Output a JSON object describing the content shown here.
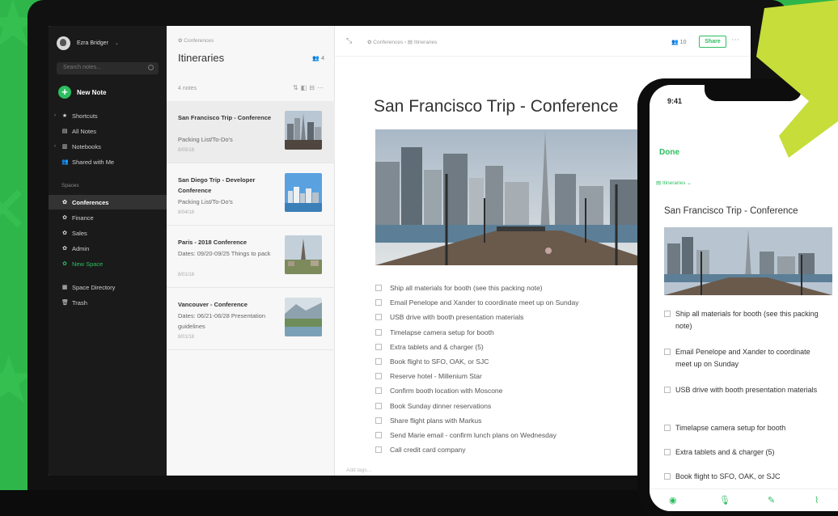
{
  "sidebar": {
    "account_name": "Ezra Bridger",
    "search_placeholder": "Search notes...",
    "new_note": "New Note",
    "items": [
      {
        "label": "Shortcuts",
        "icon": "star-icon"
      },
      {
        "label": "All Notes",
        "icon": "notes-icon"
      },
      {
        "label": "Notebooks",
        "icon": "notebook-icon"
      },
      {
        "label": "Shared with Me",
        "icon": "people-icon"
      }
    ],
    "spaces_label": "Spaces",
    "spaces": [
      {
        "label": "Conferences",
        "active": true
      },
      {
        "label": "Finance"
      },
      {
        "label": "Sales"
      },
      {
        "label": "Admin"
      },
      {
        "label": "New Space",
        "green": true
      }
    ],
    "bottom": [
      {
        "label": "Space Directory",
        "icon": "directory-icon"
      },
      {
        "label": "Trash",
        "icon": "trash-icon"
      }
    ]
  },
  "notelist": {
    "space": "Conferences",
    "title": "Itineraries",
    "people_count": "4",
    "count": "4 notes",
    "notes": [
      {
        "title": "San Francisco Trip - Conference",
        "snippet": "Packing List/To-Do's",
        "date": "8/05/18"
      },
      {
        "title": "San Diego Trip - Developer Conference",
        "snippet": "Packing List/To-Do's",
        "date": "8/04/18"
      },
      {
        "title": "Paris - 2018 Conference",
        "snippet": "Dates: 09/20-09/25 Things to pack",
        "date": "8/01/18"
      },
      {
        "title": "Vancouver - Conference",
        "snippet": "Dates: 06/21-06/28 Presentation guidelines",
        "date": "8/01/18"
      }
    ]
  },
  "editor": {
    "breadcrumb_space": "Conferences",
    "breadcrumb_notebook": "Itineraries",
    "people_count": "10",
    "share": "Share",
    "title": "San Francisco Trip - Conference",
    "checklist": [
      "Ship all materials for booth (see this packing note)",
      "Email Penelope and Xander to coordinate meet up on Sunday",
      "USB drive with booth presentation materials",
      "Timelapse camera setup for booth",
      "Extra tablets and & charger (5)",
      "Book flight to SFO, OAK, or SJC",
      "Reserve hotel - Millenium Star",
      "Confirm booth location with Moscone",
      "Book Sunday dinner reservations",
      "Share flight plans with Markus",
      "Send Marie email - confirm lunch plans on Wednesday",
      "Call credit card company"
    ],
    "add_tags": "Add tags..."
  },
  "phone": {
    "time": "9:41",
    "done": "Done",
    "notebook": "Itineraries",
    "title": "San Francisco Trip - Conference",
    "checklist": [
      "Ship all materials for booth (see this packing note)",
      "Email Penelope and Xander to coordinate meet up on Sunday",
      "USB drive with booth presentation materials",
      "Timelapse camera setup for booth",
      "Extra tablets and & charger (5)",
      "Book flight to SFO, OAK, or SJC"
    ]
  },
  "colors": {
    "accent": "#2dbe60",
    "background": "#2fb64a",
    "sidebar": "#1a1a1a"
  }
}
